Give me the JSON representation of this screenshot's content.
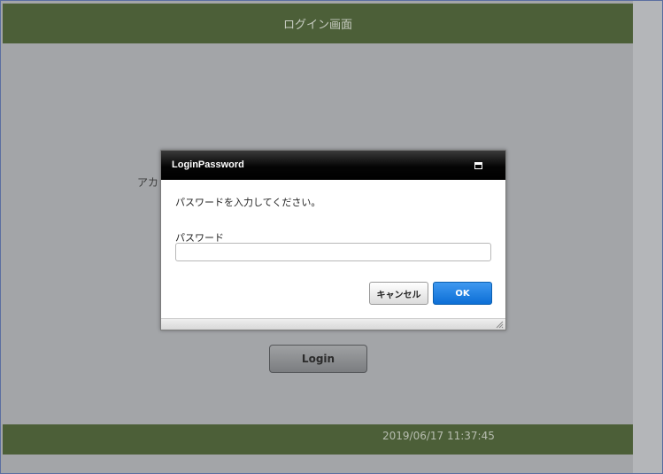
{
  "header": {
    "title": "ログイン画面"
  },
  "background": {
    "partial_label": "アカ",
    "login_button_label": "Login"
  },
  "dialog": {
    "title": "LoginPassword",
    "maximize_icon": "maximize-icon",
    "message": "パスワードを入力してください。",
    "field_label": "パスワード",
    "password_value": "",
    "password_placeholder": "",
    "cancel_label": "キャンセル",
    "ok_label": "OK",
    "resize_icon": "resize-grip-icon"
  },
  "footer": {
    "timestamp": "2019/06/17 11:37:45"
  },
  "colors": {
    "header_bg": "#4c5f38",
    "page_bg": "#a3a5a8",
    "ok_button": "#1a7ae0"
  }
}
